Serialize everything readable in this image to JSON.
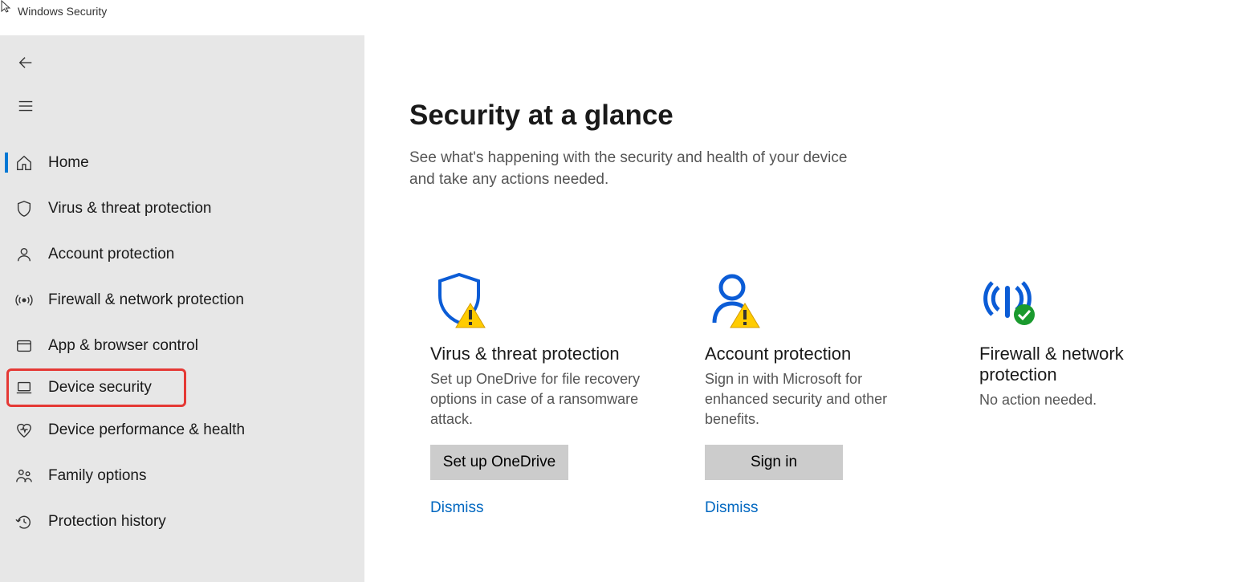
{
  "window_title": "Windows Security",
  "sidebar": {
    "items": [
      {
        "label": "Home"
      },
      {
        "label": "Virus & threat protection"
      },
      {
        "label": "Account protection"
      },
      {
        "label": "Firewall & network protection"
      },
      {
        "label": "App & browser control"
      },
      {
        "label": "Device security"
      },
      {
        "label": "Device performance & health"
      },
      {
        "label": "Family options"
      },
      {
        "label": "Protection history"
      }
    ]
  },
  "main": {
    "title": "Security at a glance",
    "subtitle": "See what's happening with the security and health of your device and take any actions needed."
  },
  "cards": [
    {
      "title": "Virus & threat protection",
      "desc": "Set up OneDrive for file recovery options in case of a ransomware attack.",
      "button": "Set up OneDrive",
      "link": "Dismiss"
    },
    {
      "title": "Account protection",
      "desc": "Sign in with Microsoft for enhanced security and other benefits.",
      "button": "Sign in",
      "link": "Dismiss"
    },
    {
      "title": "Firewall & network protection",
      "desc": "No action needed."
    }
  ]
}
